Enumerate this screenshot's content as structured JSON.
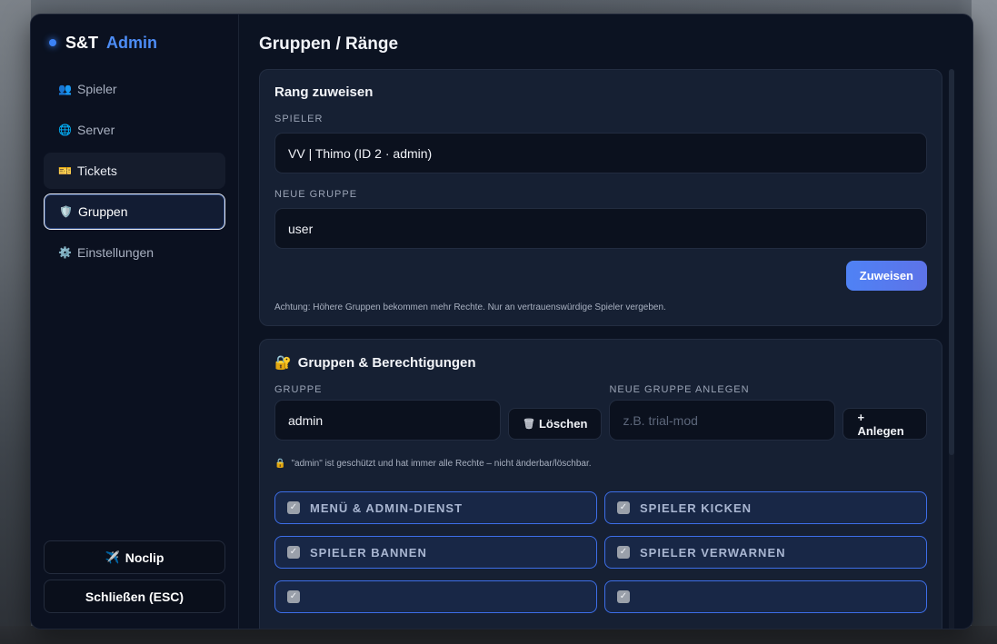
{
  "brand": {
    "part1": "S&T",
    "part2": "Admin"
  },
  "sidebar": {
    "items": [
      {
        "label": "Spieler",
        "icon": "👥"
      },
      {
        "label": "Server",
        "icon": "🌐"
      },
      {
        "label": "Tickets",
        "icon": "🎫"
      },
      {
        "label": "Gruppen",
        "icon": "🛡️"
      },
      {
        "label": "Einstellungen",
        "icon": "⚙️"
      }
    ],
    "noclip": {
      "label": "Noclip",
      "icon": "✈️"
    },
    "close": {
      "label": "Schließen (ESC)"
    }
  },
  "main": {
    "title": "Gruppen / Ränge",
    "assign": {
      "title": "Rang zuweisen",
      "player_label": "Spieler",
      "player_value": "VV | Thimo (ID 2 · admin)",
      "group_label": "Neue Gruppe",
      "group_value": "user",
      "button": "Zuweisen",
      "note": "Achtung: Höhere Gruppen bekommen mehr Rechte. Nur an vertrauenswürdige Spieler vergeben."
    },
    "groups": {
      "icon": "🔐",
      "title": "Gruppen & Berechtigungen",
      "group_label": "Gruppe",
      "group_value": "admin",
      "delete_icon": "🗑",
      "delete_button": "Löschen",
      "new_label": "Neue Gruppe anlegen",
      "new_placeholder": "z.B. trial-mod",
      "create_button": "+ Anlegen",
      "lock_icon": "🔒",
      "lock_note": "\"admin\" ist geschützt und hat immer alle Rechte – nicht änderbar/löschbar.",
      "permissions": [
        {
          "label": "Menü & Admin-Dienst",
          "checked": true
        },
        {
          "label": "Spieler kicken",
          "checked": true
        },
        {
          "label": "Spieler bannen",
          "checked": true
        },
        {
          "label": "Spieler verwarnen",
          "checked": true
        }
      ]
    }
  }
}
